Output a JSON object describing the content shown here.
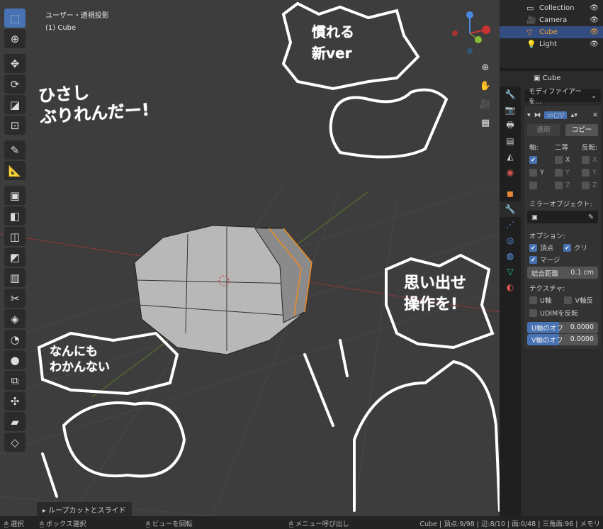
{
  "viewport": {
    "view_name": "ユーザー・透視投影",
    "object": "(1) Cube",
    "last_operator": "ループカットとスライド"
  },
  "doodles": [
    "ひさし\nぶりれんだー!",
    "慣れる\n新ver",
    "なんにも\nわかんない",
    "思い出せ\n操作を!"
  ],
  "toolbar": [
    "select-box",
    "cursor",
    "move",
    "rotate",
    "scale",
    "transform",
    "annotate",
    "measure",
    "add-cube",
    "extrude",
    "inset",
    "bevel",
    "loop-cut",
    "knife",
    "poly-build",
    "spin",
    "smooth",
    "edge-slide",
    "shrink",
    "shear",
    "rip"
  ],
  "outliner": {
    "items": [
      {
        "label": "Collection",
        "icon": "collection-icon"
      },
      {
        "label": "Camera",
        "icon": "camera-icon"
      },
      {
        "label": "Cube",
        "icon": "mesh-icon",
        "selected": true
      },
      {
        "label": "Light",
        "icon": "light-icon"
      }
    ]
  },
  "properties": {
    "object_name": "Cube",
    "add_modifier": "モディファイアー を...",
    "apply": "適用",
    "copy": "コピー",
    "axis_label": "軸:",
    "bisect_label": "二等",
    "flip_label": "反転:",
    "x": "X",
    "y": "Y",
    "z": "Z",
    "mirror_object_label": "ミラーオブジェクト:",
    "options_label": "オプション:",
    "vertex": "頂点",
    "clip": "クリ",
    "merge": "マージ",
    "merge_distance_label": "結合距離",
    "merge_distance": "0.1 cm",
    "texture_label": "テクスチャ:",
    "u_axis": "U軸",
    "v_axis": "V軸反",
    "udim": "UDIMを反転",
    "u_offset_label": "U軸のオフ",
    "u_offset": "0.0000",
    "v_offset_label": "V軸のオフ",
    "v_offset": "0.0000"
  },
  "status": {
    "select": "選択",
    "box_select": "ボックス選択",
    "rotate_view": "ビューを回転",
    "menu": "メニュー呼び出し",
    "stats": "Cube | 頂点:9/98 | 辺:8/10 | 面:0/48 | 三角面:96 | メモリ"
  },
  "colors": {
    "accent": "#4772b3",
    "selected_orange": "#f0a030",
    "viewport_bg": "#3d3d3d"
  }
}
